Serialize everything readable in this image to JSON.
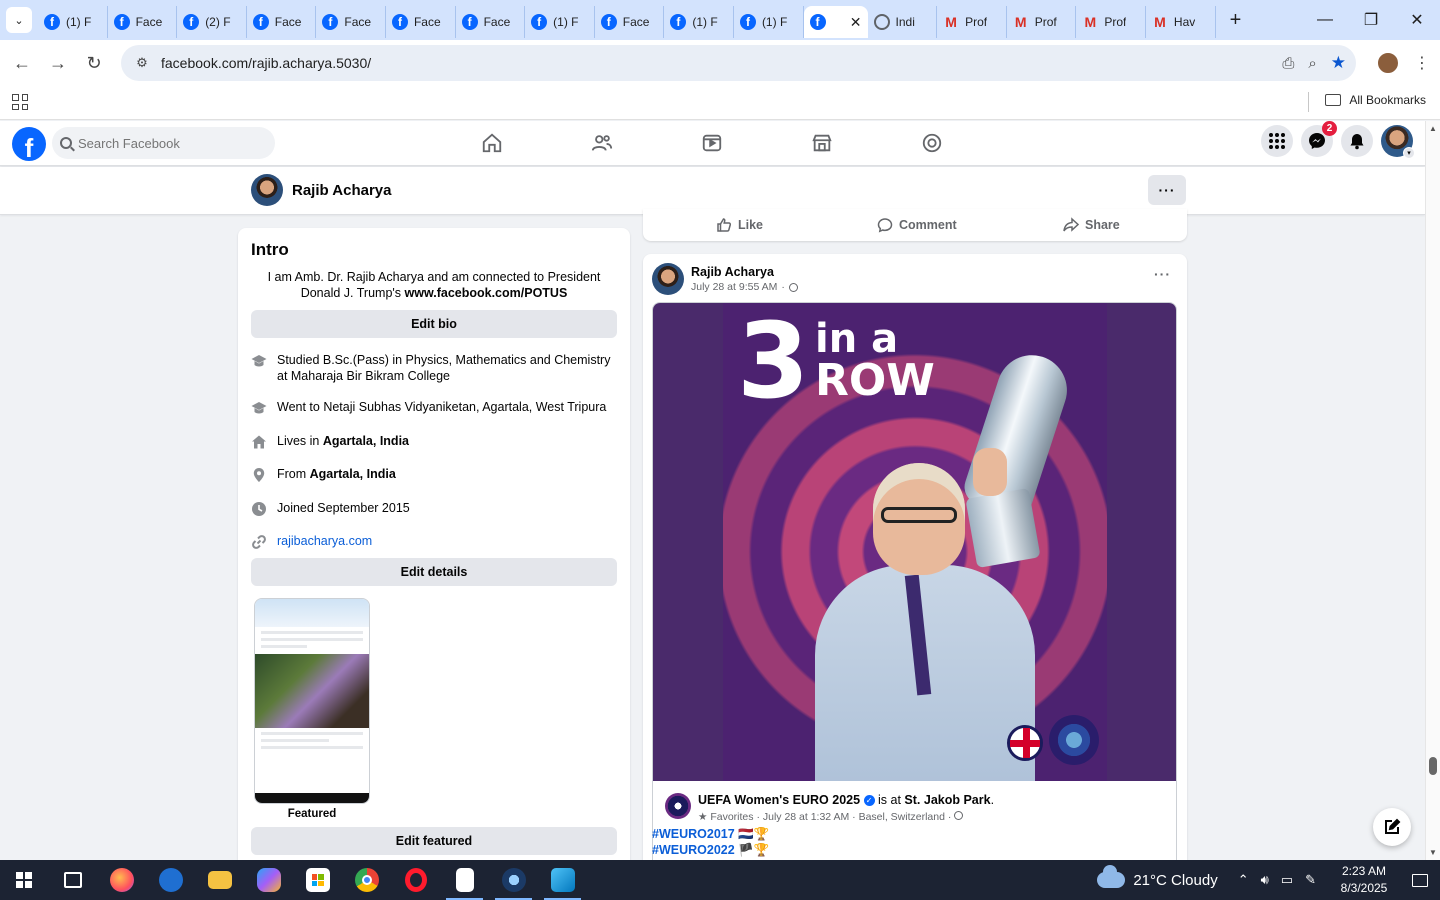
{
  "browser": {
    "tabs": [
      {
        "icon": "facebook",
        "label": "(1) F"
      },
      {
        "icon": "facebook",
        "label": "Face"
      },
      {
        "icon": "facebook",
        "label": "(2) F"
      },
      {
        "icon": "facebook",
        "label": "Face"
      },
      {
        "icon": "facebook",
        "label": "Face"
      },
      {
        "icon": "facebook",
        "label": "Face"
      },
      {
        "icon": "facebook",
        "label": "Face"
      },
      {
        "icon": "facebook",
        "label": "(1) F"
      },
      {
        "icon": "facebook",
        "label": "Face"
      },
      {
        "icon": "facebook",
        "label": "(1) F"
      },
      {
        "icon": "facebook",
        "label": "(1) F"
      },
      {
        "icon": "facebook",
        "label": "",
        "active": true
      },
      {
        "icon": "globe",
        "label": "Indi"
      },
      {
        "icon": "gmail",
        "label": "Prof"
      },
      {
        "icon": "gmail",
        "label": "Prof"
      },
      {
        "icon": "gmail",
        "label": "Prof"
      },
      {
        "icon": "gmail",
        "label": "Hav"
      }
    ],
    "url": "facebook.com/rajib.acharya.5030/",
    "all_bookmarks": "All Bookmarks"
  },
  "facebook": {
    "search_placeholder": "Search Facebook",
    "notifications_badge": "2",
    "profile_name": "Rajib Acharya",
    "more_label": "···"
  },
  "intro": {
    "title": "Intro",
    "bio_text": "I am Amb. Dr. Rajib Acharya and am connected to President Donald J. Trump's ",
    "bio_link": "www.facebook.com/POTUS",
    "edit_bio": "Edit bio",
    "details": [
      {
        "icon": "graduation-cap",
        "prefix": "Studied B.Sc.(Pass) in Physics, Mathematics and Chemistry at Maharaja Bir Bikram College",
        "bold": ""
      },
      {
        "icon": "graduation-cap",
        "prefix": "Went to Netaji Subhas Vidyaniketan, Agartala, West Tripura",
        "bold": ""
      },
      {
        "icon": "home",
        "prefix": "Lives in ",
        "bold": "Agartala, India"
      },
      {
        "icon": "location-pin",
        "prefix": "From ",
        "bold": "Agartala, India"
      },
      {
        "icon": "clock",
        "prefix": "Joined September 2015",
        "bold": ""
      }
    ],
    "website": "rajibacharya.com",
    "edit_details": "Edit details",
    "featured_label": "Featured",
    "edit_featured": "Edit featured"
  },
  "previous_post_actions": {
    "like": "Like",
    "comment": "Comment",
    "share": "Share"
  },
  "post": {
    "author": "Rajib Acharya",
    "time": "July 28 at 9:55 AM",
    "more": "···",
    "image_text_number": "3",
    "image_text_top": "in a",
    "image_text_bottom": "ROW",
    "shared_page": "UEFA Women's EURO 2025",
    "shared_connector": " is at ",
    "shared_place": "St. Jakob Park",
    "shared_meta": "Favorites · July 28 at 1:32 AM · Basel, Switzerland ·",
    "hashtags": [
      {
        "tag": "#WEURO2017",
        "emoji": " 🇳🇱🏆"
      },
      {
        "tag": "#WEURO2022",
        "emoji": " 🏴🏆"
      }
    ]
  },
  "taskbar": {
    "weather": "21°C  Cloudy",
    "time": "2:23 AM",
    "date": "8/3/2025"
  }
}
